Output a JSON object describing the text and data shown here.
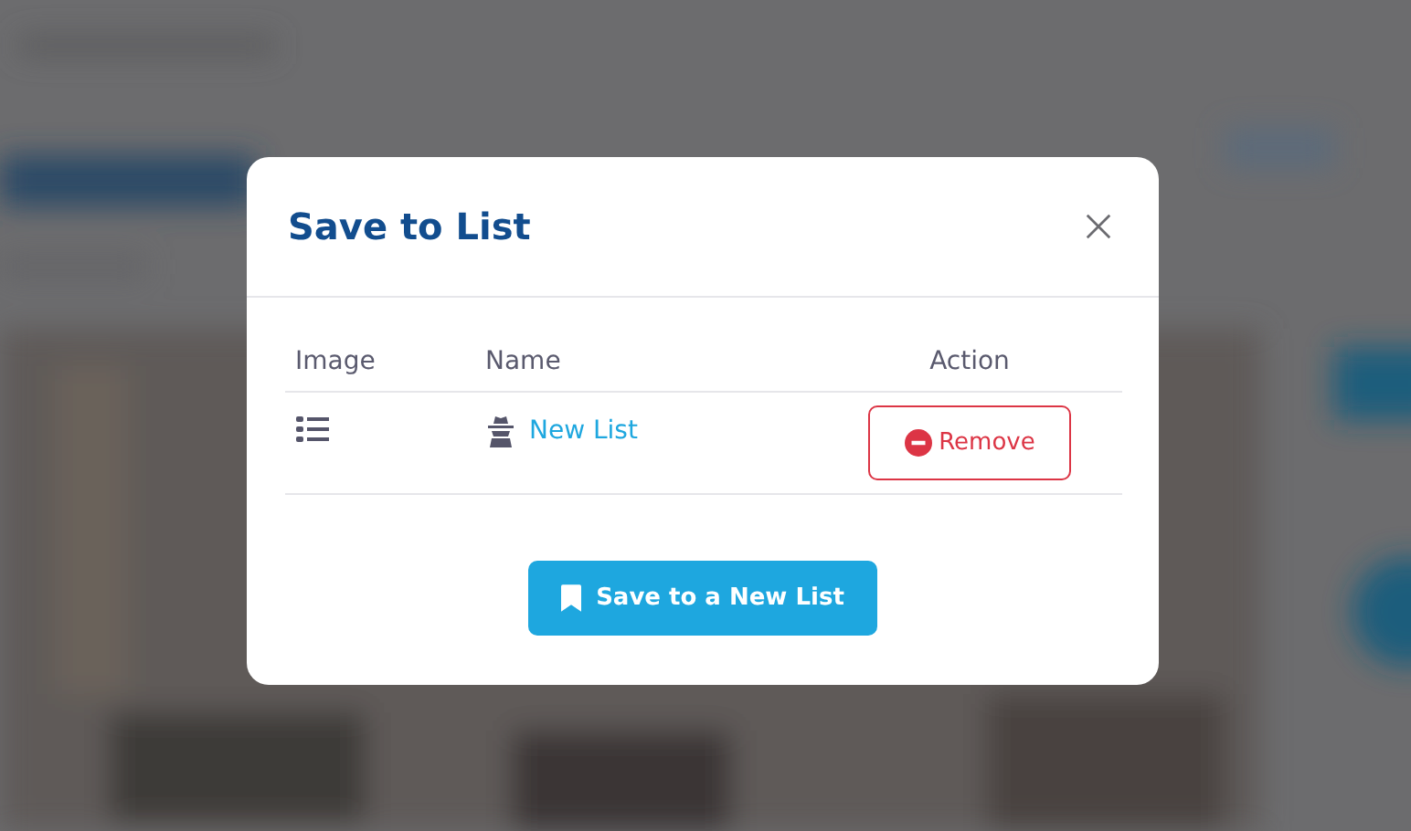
{
  "dialog": {
    "title": "Save to List",
    "table": {
      "columns": [
        "Image",
        "Name",
        "Action"
      ],
      "rows": [
        {
          "name": "New List",
          "action": "Remove"
        }
      ]
    },
    "button": "Save to a New List"
  }
}
